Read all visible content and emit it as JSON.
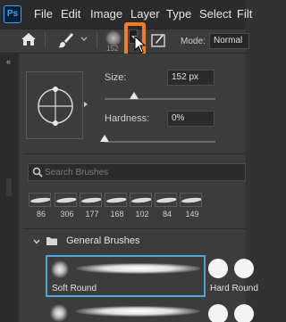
{
  "app": {
    "logo": "Ps",
    "menu": [
      "File",
      "Edit",
      "Image",
      "Layer",
      "Type",
      "Select",
      "Filt"
    ]
  },
  "options_bar": {
    "home_icon": "home-icon",
    "brush_icon": "brush-icon",
    "preset_size": "152",
    "mode_label": "Mode:",
    "mode_value": "Normal",
    "highlight_color": "#f07c23"
  },
  "toolstrip": {
    "collapse": "«"
  },
  "brush_panel": {
    "size_label": "Size:",
    "size_value": "152 px",
    "size_fraction": 0.27,
    "hardness_label": "Hardness:",
    "hardness_value": "0%",
    "hardness_fraction": 0.0,
    "search_placeholder": "Search Brushes",
    "recent_sizes": [
      "86",
      "306",
      "177",
      "168",
      "102",
      "84",
      "149"
    ],
    "group_name": "General Brushes",
    "brushes": [
      {
        "name": "Soft Round",
        "selected": true
      },
      {
        "name": "Hard Round",
        "selected": false
      }
    ],
    "accent": "#4aa8d8"
  }
}
